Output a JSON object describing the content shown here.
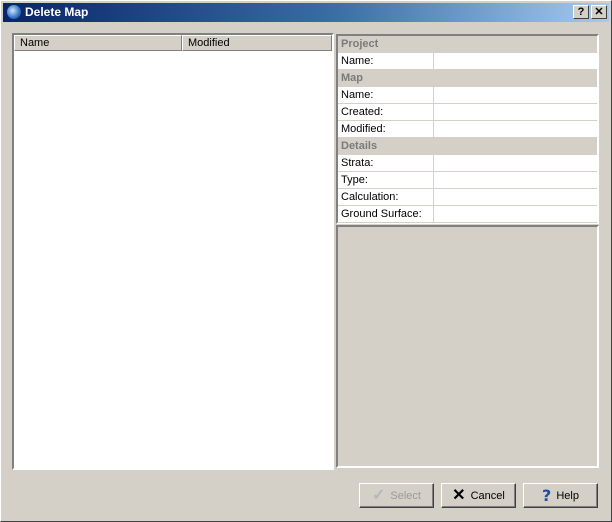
{
  "window": {
    "title": "Delete Map",
    "help_glyph": "?",
    "close_glyph": "✕"
  },
  "list": {
    "columns": [
      "Name",
      "Modified"
    ]
  },
  "properties": {
    "project": {
      "heading": "Project",
      "name_label": "Name:",
      "name_value": ""
    },
    "map": {
      "heading": "Map",
      "name_label": "Name:",
      "name_value": "",
      "created_label": "Created:",
      "created_value": "",
      "modified_label": "Modified:",
      "modified_value": ""
    },
    "details": {
      "heading": "Details",
      "strata_label": "Strata:",
      "strata_value": "",
      "type_label": "Type:",
      "type_value": "",
      "calculation_label": "Calculation:",
      "calculation_value": "",
      "ground_surface_label": "Ground Surface:",
      "ground_surface_value": ""
    }
  },
  "buttons": {
    "select": {
      "label": "Select",
      "icon": "check-icon",
      "enabled": false
    },
    "cancel": {
      "label": "Cancel",
      "icon": "x-icon"
    },
    "help": {
      "label": "Help",
      "icon": "question-icon"
    }
  }
}
